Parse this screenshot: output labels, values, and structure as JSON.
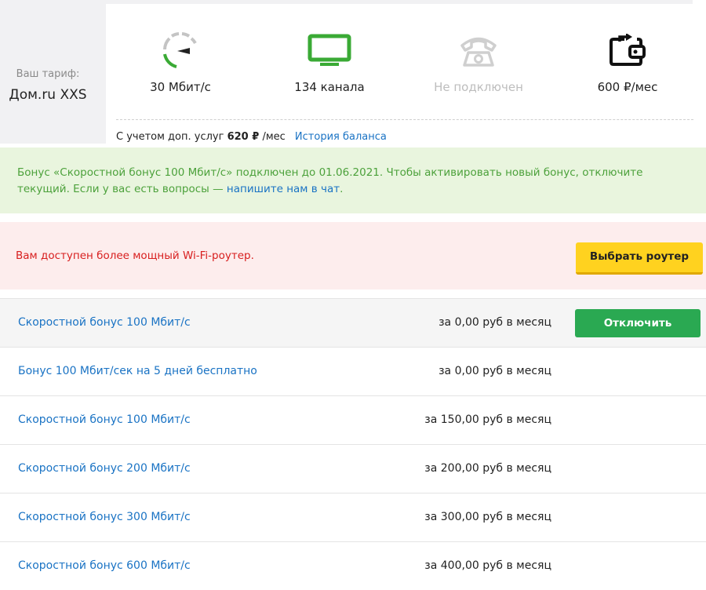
{
  "tariff": {
    "label": "Ваш тариф:",
    "name": "Дом.ru XXS"
  },
  "stats": {
    "speed": {
      "icon": "speedometer-icon",
      "value": "30 Мбит/с"
    },
    "tv": {
      "icon": "tv-icon",
      "value": "134 канала"
    },
    "phone": {
      "icon": "phone-icon",
      "value": "Не подключен",
      "state": "disabled"
    },
    "payment": {
      "icon": "wallet-icon",
      "value": "600 ₽/мес"
    }
  },
  "balance": {
    "prefix": "С учетом доп. услуг",
    "amount": "620 ₽",
    "suffix": "/мес",
    "history_link": "История баланса"
  },
  "bonus_notice": {
    "text": "Бонус «Скоростной бонус 100 Мбит/с» подключен до 01.06.2021. Чтобы активировать новый бонус, отключите текущий. Если у вас есть вопросы — ",
    "link": "напишите нам в чат",
    "end": "."
  },
  "router_offer": {
    "message": "Вам доступен более мощный Wi-Fi-роутер.",
    "button": "Выбрать роутер"
  },
  "bonuses": [
    {
      "name": "Скоростной бонус 100 Мбит/с",
      "price": "за 0,00 руб в месяц",
      "action": "Отключить"
    },
    {
      "name": "Бонус 100 Мбит/сек на 5 дней бесплатно",
      "price": "за 0,00 руб в месяц"
    },
    {
      "name": "Скоростной бонус 100 Мбит/с",
      "price": "за 150,00 руб в месяц"
    },
    {
      "name": "Скоростной бонус 200 Мбит/с",
      "price": "за 200,00 руб в месяц"
    },
    {
      "name": "Скоростной бонус 300 Мбит/с",
      "price": "за 300,00 руб в месяц"
    },
    {
      "name": "Скоростной бонус 600 Мбит/с",
      "price": "за 400,00 руб в месяц"
    }
  ],
  "colors": {
    "accent_link": "#1a73c4",
    "success_green": "#2aa952",
    "notice_green_text": "#4ca13b",
    "alert_red_text": "#d81e1e",
    "primary_yellow": "#ffd21f"
  }
}
